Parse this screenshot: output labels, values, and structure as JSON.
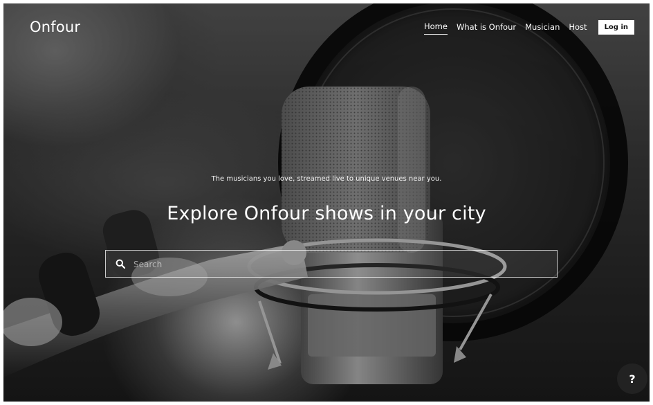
{
  "header": {
    "logo": "Onfour",
    "nav": [
      {
        "label": "Home",
        "active": true
      },
      {
        "label": "What is Onfour",
        "active": false
      },
      {
        "label": "Musician",
        "active": false
      },
      {
        "label": "Host",
        "active": false
      }
    ],
    "login_label": "Log in"
  },
  "hero": {
    "tagline": "The musicians you love, streamed live to unique venues near you.",
    "title": "Explore Onfour shows in your city"
  },
  "search": {
    "placeholder": "Search",
    "value": "",
    "icon": "search-icon"
  },
  "help": {
    "label": "?",
    "icon": "help-icon"
  },
  "colors": {
    "text": "#ffffff",
    "login_bg": "#ffffff",
    "login_text": "#111111",
    "help_bg": "#222222"
  }
}
